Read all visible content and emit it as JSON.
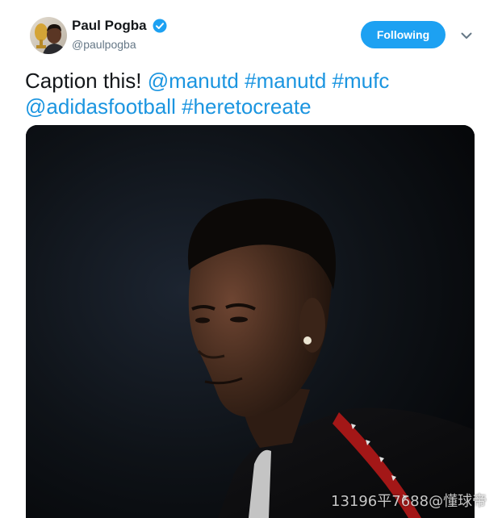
{
  "tweet": {
    "author": {
      "name": "Paul Pogba",
      "handle": "@paulpogba",
      "verified": true,
      "avatar_icon": "avatar-photo",
      "verified_icon": "verified-badge-icon"
    },
    "follow_button": {
      "label": "Following"
    },
    "menu_icon": "chevron-down-icon",
    "text_lines": [
      [
        "Caption this!",
        "@manutd",
        "#manutd",
        "#mufc"
      ],
      [
        "@adidasfootball",
        "#heretocreate"
      ]
    ]
  },
  "photo": {
    "watermark": "13196平7688@懂球帝"
  },
  "colors": {
    "accent": "#1da1f2",
    "link": "#1b95e0",
    "text": "#14171a",
    "muted": "#657786"
  }
}
